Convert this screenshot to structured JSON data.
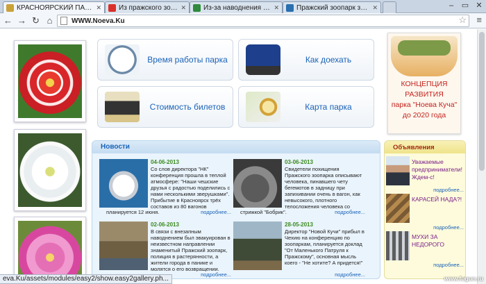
{
  "tabs": [
    {
      "title": "КРАСНОЯРСКИЙ ПАРК ФЛОР",
      "fav": "#c9a23a"
    },
    {
      "title": "Из пражского зоопарка на",
      "fav": "#d9312a"
    },
    {
      "title": "Из-за наводнения в Праге",
      "fav": "#2e8a3c"
    },
    {
      "title": "Пражский зоопарк закры",
      "fav": "#2a6fb0"
    }
  ],
  "address": {
    "url": "WWW.Noeva.Ku"
  },
  "features": [
    {
      "label": "Время работы парка",
      "icon": "clock-icon"
    },
    {
      "label": "Как доехать",
      "icon": "bus-icon"
    },
    {
      "label": "Стоимость билетов",
      "icon": "cash-register-icon"
    },
    {
      "label": "Карта парка",
      "icon": "map-compass-icon"
    }
  ],
  "concept": {
    "lines": [
      "КОНЦЕПЦИЯ",
      "РАЗВИТИЯ",
      "парка \"Ноева Куча\"",
      "до 2020 года"
    ]
  },
  "news": {
    "header": "Новости",
    "items": [
      {
        "date": "04-06-2013",
        "text": "Со слов директора \"НК\" конференция прошла в теплой атмосфере: \"Наши чешские друзья с радостью поделились с нами несколькими зверушками\". Прибытие в Красноярск трёх составов из 80 вагонов",
        "tail": "планируется 12 июня.",
        "more": "подробнее..."
      },
      {
        "date": "03-06-2013",
        "text": "Свидетели похищения Пражского зоопарка описывают человека, пинавшего чету бегемотов в задницу при запихивании очень в вагон, как невысокого, плотного телосложения человека со",
        "tail": "стрижкой \"Бобрик\".",
        "more": "подробнее..."
      },
      {
        "date": "02-06-2013",
        "text": "В связи с внезапным наводнением был эвакуирован в неизвестном направлении знаменитый Пражский зоопарк, полиция в растерянности, а жители города в панике и молятся о его возвращении.",
        "tail": "",
        "more": "подробнее..."
      },
      {
        "date": "28-05-2013",
        "text": "Директор \"Новой Кучи\" прибыл в Чехию на конференцию по зоопаркам, планируется доклад \"От Маленького Патруля к Пражскому\", основная мысль коего - \"Не хотите? А придется!\"",
        "tail": "",
        "more": "подробнее..."
      }
    ]
  },
  "ads": {
    "header": "Объявления",
    "items": [
      {
        "text": "Уважаемые предприниматели! Ждем-с!",
        "more": "подробнее..."
      },
      {
        "text": "КАРАСЕЙ НАДА?!",
        "more": "подробнее..."
      },
      {
        "text": "МУХИ ЗА НЕДОРОГО",
        "more": "подробнее..."
      }
    ]
  },
  "status": {
    "text": "eva.Ku/assets/modules/easy2/show.easy2gallery.ph..."
  },
  "watermark": "www.fugun.ru",
  "colors": {
    "link": "#1a62b8",
    "date": "#3a8a1e",
    "concept": "#c4231e",
    "ad_text": "#7a1d88"
  }
}
